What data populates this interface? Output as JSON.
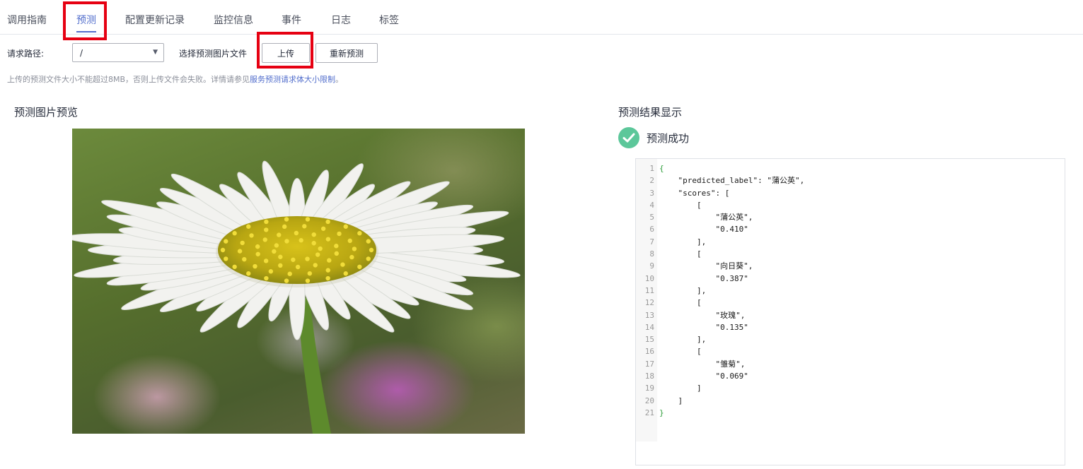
{
  "tabs": [
    {
      "label": "调用指南",
      "active": false
    },
    {
      "label": "预测",
      "active": true
    },
    {
      "label": "配置更新记录",
      "active": false
    },
    {
      "label": "监控信息",
      "active": false
    },
    {
      "label": "事件",
      "active": false
    },
    {
      "label": "日志",
      "active": false
    },
    {
      "label": "标签",
      "active": false
    }
  ],
  "toolbar": {
    "path_label": "请求路径:",
    "path_value": "/",
    "choose_file_label": "选择预测图片文件",
    "upload_button": "上传",
    "repredict_button": "重新预测"
  },
  "hint": {
    "text": "上传的预测文件大小不能超过8MB，否则上传文件会失败。详情请参见",
    "link": "服务预测请求体大小限制",
    "suffix": "。"
  },
  "preview": {
    "title": "预测图片预览"
  },
  "result": {
    "title": "预测结果显示",
    "status": "预测成功",
    "lines": [
      "{",
      "    \"predicted_label\": \"蒲公英\",",
      "    \"scores\": [",
      "        [",
      "            \"蒲公英\",",
      "            \"0.410\"",
      "        ],",
      "        [",
      "            \"向日葵\",",
      "            \"0.387\"",
      "        ],",
      "        [",
      "            \"玫瑰\",",
      "            \"0.135\"",
      "        ],",
      "        [",
      "            \"雏菊\",",
      "            \"0.069\"",
      "        ]",
      "    ]",
      "}"
    ]
  },
  "colors": {
    "accent": "#526ecc",
    "highlight": "#e60012",
    "success": "#5cc79a"
  }
}
